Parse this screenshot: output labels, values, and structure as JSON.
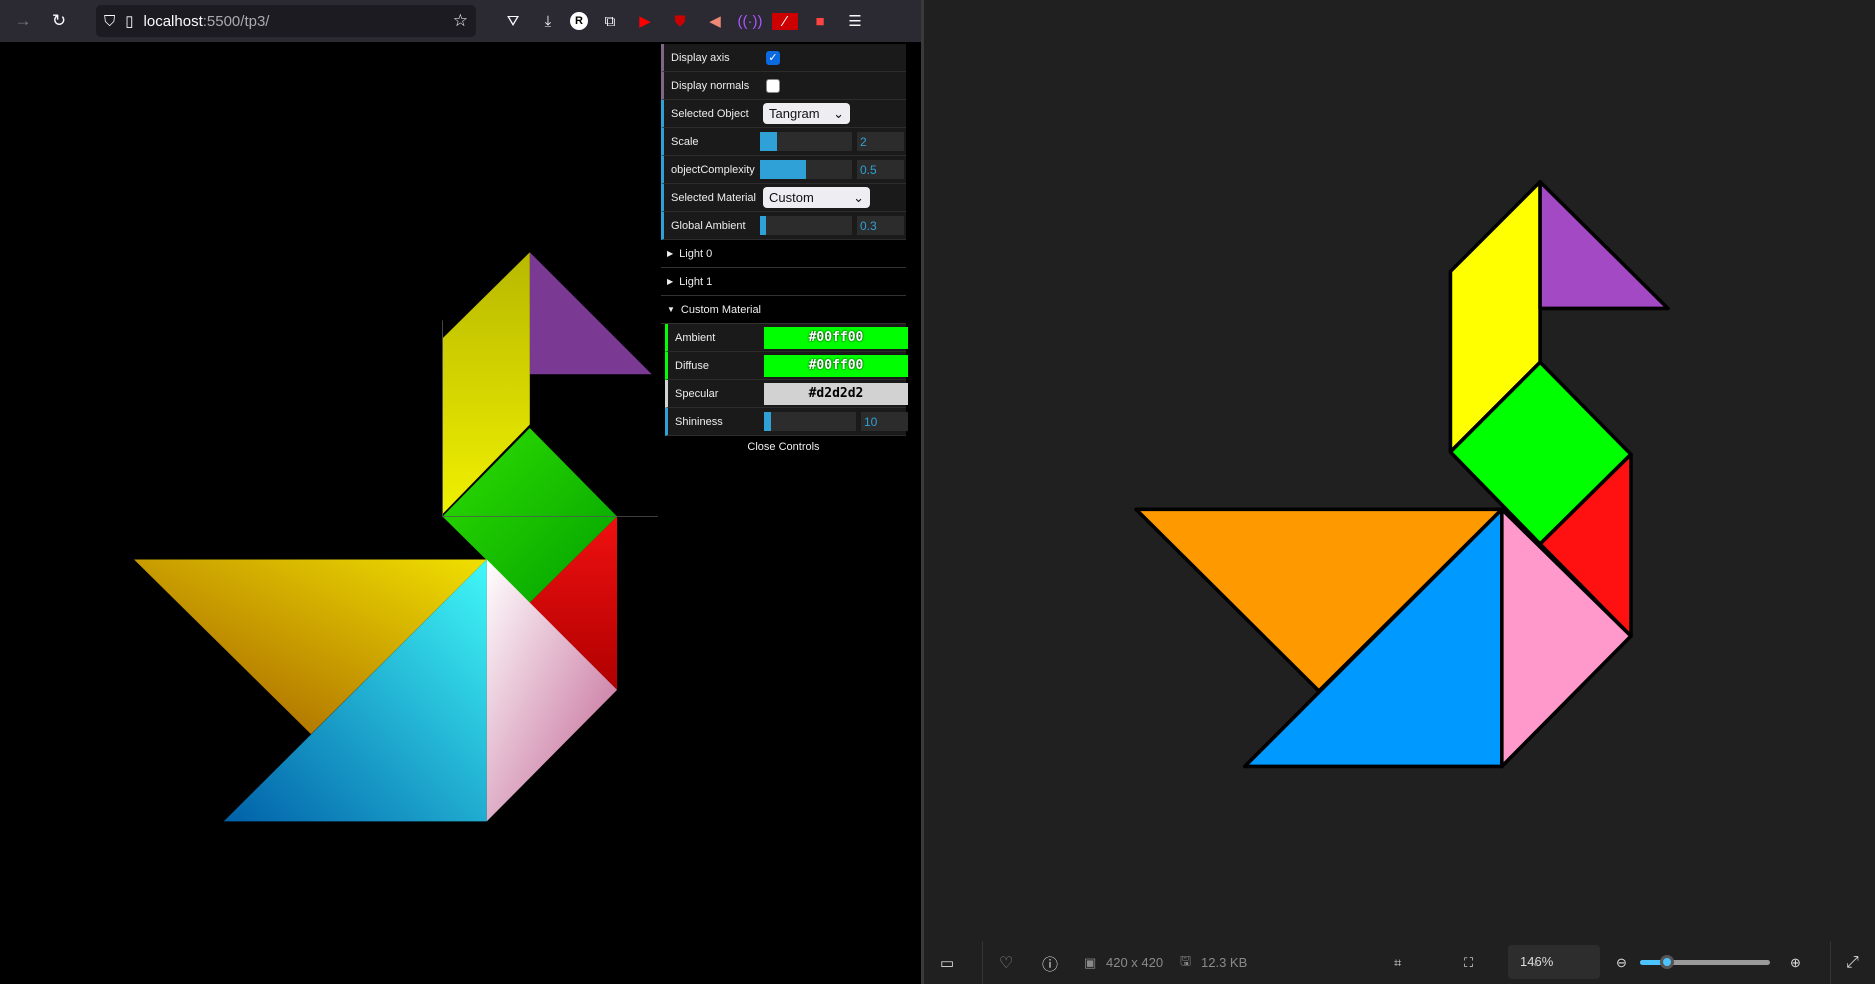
{
  "browser": {
    "url_host": "localhost",
    "url_path": ":5500/tp3/"
  },
  "gui": {
    "display_axis": {
      "label": "Display axis",
      "checked": true
    },
    "display_normals": {
      "label": "Display normals",
      "checked": false
    },
    "selected_object": {
      "label": "Selected Object",
      "value": "Tangram"
    },
    "scale": {
      "label": "Scale",
      "value": "2",
      "fill_percent": 15
    },
    "complexity": {
      "label": "objectComplexity",
      "value": "0.5",
      "fill_percent": 50
    },
    "selected_material": {
      "label": "Selected Material",
      "value": "Custom"
    },
    "global_ambient": {
      "label": "Global Ambient",
      "value": "0.3",
      "fill_percent": 6
    },
    "folders": {
      "light0": "Light 0",
      "light1": "Light 1",
      "custom": "Custom Material"
    },
    "material": {
      "ambient": {
        "label": "Ambient",
        "value": "#00ff00"
      },
      "diffuse": {
        "label": "Diffuse",
        "value": "#00ff00"
      },
      "specular": {
        "label": "Specular",
        "value": "#d2d2d2"
      },
      "shininess": {
        "label": "Shininess",
        "value": "10",
        "fill_percent": 8
      }
    },
    "close": "Close Controls"
  },
  "viewer": {
    "dimensions": "420 x 420",
    "size": "12.3 KB",
    "zoom": "146%"
  },
  "tangram_colors": {
    "yellow": "#ffff00",
    "purple": "#a349c4",
    "green": "#00ff00",
    "red": "#ff1111",
    "orange": "#ff9900",
    "blue": "#0099ff",
    "pink": "#ff99cc"
  }
}
